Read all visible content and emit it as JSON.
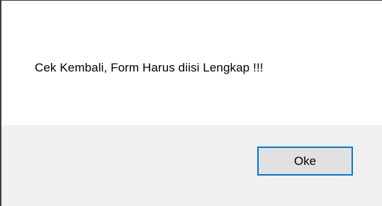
{
  "dialog": {
    "message": "Cek Kembali, Form Harus diisi Lengkap !!!",
    "ok_label": "Oke"
  },
  "colors": {
    "accent": "#0078d7",
    "footer_bg": "#f0f0f0",
    "button_bg": "#e1e1e1"
  }
}
